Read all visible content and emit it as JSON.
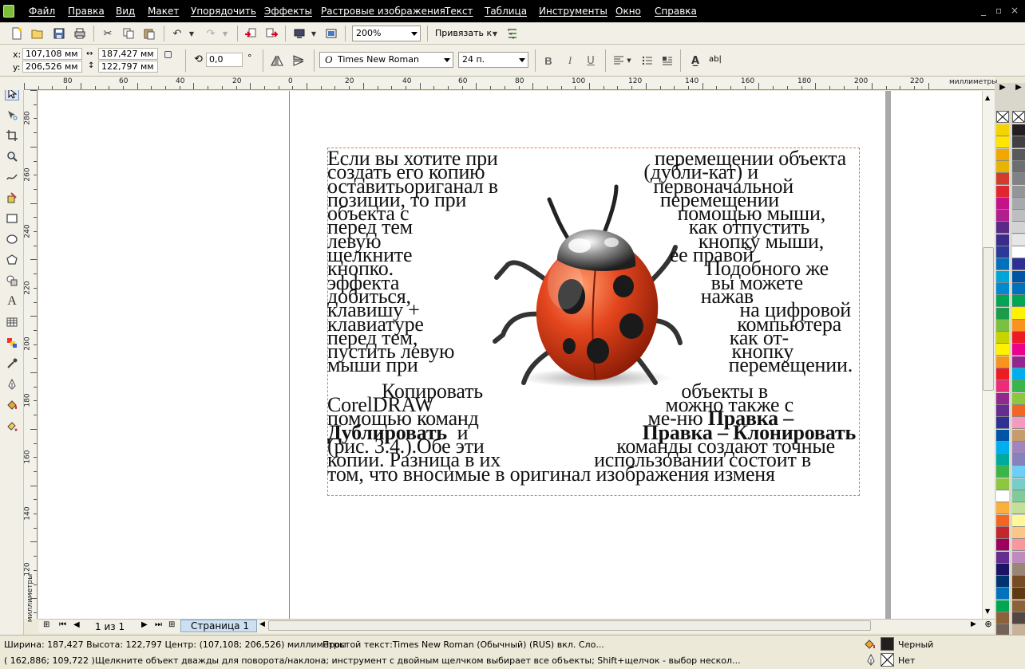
{
  "menu": [
    "Файл",
    "Правка",
    "Вид",
    "Макет",
    "Упорядочить",
    "Эффекты",
    "Растровые изображения",
    "Текст",
    "Таблица",
    "Инструменты",
    "Окно",
    "Справка"
  ],
  "window_controls": [
    "_",
    "▫",
    "×"
  ],
  "toolbar": {
    "zoom": "200%",
    "snap": "Привязать к"
  },
  "props": {
    "x_label": "x:",
    "x": "107,108 мм",
    "y_label": "y:",
    "y": "206,526 мм",
    "w": "187,427 мм",
    "h": "122,797 мм",
    "angle": "0,0",
    "degree": "°",
    "font": "Times New Roman",
    "font_size": "24 п.",
    "text_tool": "ab|"
  },
  "ruler": {
    "h_ticks": [
      "80",
      "60",
      "40",
      "20",
      "0",
      "20",
      "40",
      "60",
      "80",
      "100",
      "120",
      "140",
      "160",
      "180",
      "200",
      "220"
    ],
    "units": "миллиметры",
    "v_ticks": [
      "280",
      "260",
      "240",
      "220",
      "200",
      "180",
      "160",
      "140",
      "120"
    ],
    "v_units": "миллиметры"
  },
  "text_lines": [
    [
      "Если вы хотите при",
      "перемещении объекта"
    ],
    [
      "создать его копию",
      "(дубли-кат) и"
    ],
    [
      "оставитьориганал в",
      "первоначальной"
    ],
    [
      "позиции, то при",
      "перемещении"
    ],
    [
      "объекта с",
      "помощью мыши,"
    ],
    [
      "перед тем",
      "как отпустить"
    ],
    [
      "левую",
      "кнопку мыши,"
    ],
    [
      "щелкните",
      "ее правой"
    ],
    [
      "кнопко.",
      "Подобного же"
    ],
    [
      "эффекта",
      "вы можете"
    ],
    [
      "добиться,",
      "нажав"
    ],
    [
      "клавишу +",
      "на цифровой"
    ],
    [
      "клавиатуре",
      "компьютера"
    ],
    [
      "перед тем,",
      "как от-"
    ],
    [
      "пустить левую",
      "кнопку"
    ],
    [
      "мыши при",
      "перемещении."
    ]
  ],
  "text_para2": {
    "l1a": "Копировать",
    "l1b": "объекты в",
    "l2a": "CorelDRAW",
    "l2b": "можно также с",
    "l3a": "помощью команд",
    "l3b": "ме-ню ",
    "l3c": "Правка –",
    "l4a": "Дублировать",
    "l4b": "и",
    "l4c": "Правка – Клонировать",
    "l5a": "(рис. 3.4.).Обе эти",
    "l5b": "команды создают точные",
    "l6a": "копии. Разница в их",
    "l6b": "использовании состоит в",
    "l7": "том, что вносимые в оригинал изображения изменя"
  },
  "pager": {
    "count": "1 из 1",
    "tab": "Страница 1"
  },
  "status": {
    "line1": "Ширина: 187,427 Высота: 122,797 Центр: (107,108; 206,526)  миллиметры",
    "line1b": "Простой текст:Times New Roman (Обычный) (RUS) вкл. Сло...",
    "coords": "( 162,886; 109,722 )",
    "hint": "Щелкните объект дважды для поворота/наклона; инструмент с двойным щелчком выбирает все объекты; Shift+щелчок - выбор нескол...",
    "fill": "Черный",
    "outline": "Нет"
  },
  "colors": {
    "menubar": "#000000",
    "frame": "#e07a4a",
    "ladybug_body": "#d8401c",
    "page_tab": "#cde0f2"
  },
  "palette_left": [
    "#f5d300",
    "#ffe600",
    "#f0a800",
    "#e8b400",
    "#d43b2c",
    "#e0262e",
    "#c4128a",
    "#b21e8e",
    "#5b2a88",
    "#3a2c8a",
    "#2b3a96",
    "#0071bc",
    "#00a4d8",
    "#0089cf",
    "#00a651",
    "#1c9b48",
    "#7ac143",
    "#c8d400",
    "#fff200",
    "#f7941d",
    "#ed1c24",
    "#ee2a7b",
    "#92278f",
    "#662d91",
    "#2e3192",
    "#0054a6",
    "#00aeef",
    "#00a99d",
    "#39b54a",
    "#8dc63f",
    "#ffffff",
    "#fbb03b",
    "#f26522",
    "#c1272d",
    "#9e005d",
    "#662d91",
    "#1b1464",
    "#003471",
    "#0072bc",
    "#00a651",
    "#8c6239",
    "#736357"
  ],
  "palette_right": [
    "#231f20",
    "#414042",
    "#58595b",
    "#6d6e71",
    "#808285",
    "#939598",
    "#a7a9ac",
    "#bcbec0",
    "#d1d3d4",
    "#e6e7e8",
    "#ffffff",
    "#2e3192",
    "#0054a6",
    "#0072bc",
    "#00a651",
    "#fff200",
    "#f7941d",
    "#ed1c24",
    "#ec008c",
    "#92278f",
    "#00aeef",
    "#39b54a",
    "#8dc63f",
    "#f26522",
    "#f49ac1",
    "#c69c6d",
    "#a186be",
    "#8781bd",
    "#6dcff6",
    "#7accc8",
    "#82ca9c",
    "#c4df9b",
    "#fff799",
    "#fdc689",
    "#f6989d",
    "#bd8cbf",
    "#998675",
    "#754c24",
    "#603913",
    "#8c6239",
    "#534741",
    "#c7b299"
  ]
}
